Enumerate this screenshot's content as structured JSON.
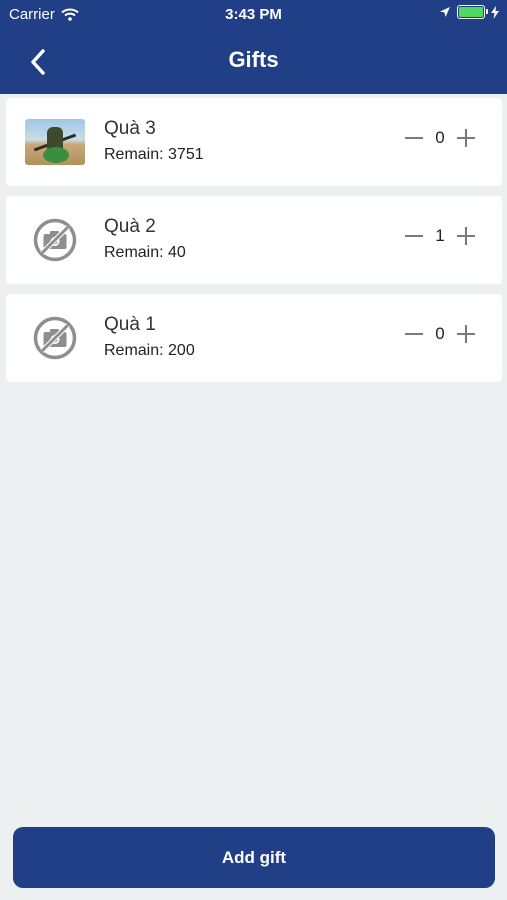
{
  "status_bar": {
    "carrier": "Carrier",
    "time": "3:43 PM"
  },
  "nav": {
    "title": "Gifts"
  },
  "gifts": [
    {
      "name": "Quà 3",
      "remain": "Remain: 3751",
      "quantity": "0",
      "thumbnail": "photo"
    },
    {
      "name": "Quà 2",
      "remain": "Remain: 40",
      "quantity": "1",
      "thumbnail": "no-photo-icon"
    },
    {
      "name": "Quà 1",
      "remain": "Remain: 200",
      "quantity": "0",
      "thumbnail": "no-photo-icon"
    }
  ],
  "actions": {
    "add_gift_label": "Add gift"
  },
  "colors": {
    "primary": "#213f86",
    "background": "#ecf0f1",
    "card": "#ffffff",
    "battery": "#4cd964"
  }
}
